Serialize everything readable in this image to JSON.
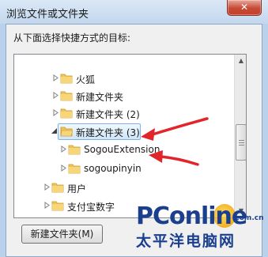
{
  "window": {
    "title": "浏览文件或文件夹",
    "close_glyph": "✕",
    "instruction": "从下面选择快捷方式的目标:"
  },
  "tree": {
    "items": [
      {
        "label": "火狐",
        "expander": "collapsed",
        "selected": false
      },
      {
        "label": "新建文件夹",
        "expander": "collapsed",
        "selected": false
      },
      {
        "label": "新建文件夹 (2)",
        "expander": "collapsed",
        "selected": false
      },
      {
        "label": "新建文件夹 (3)",
        "expander": "expanded",
        "selected": true
      },
      {
        "label": "SogouExtension",
        "expander": "collapsed",
        "selected": false
      },
      {
        "label": "sogoupinyin",
        "expander": "collapsed",
        "selected": false
      },
      {
        "label": "用户",
        "expander": "collapsed",
        "selected": false
      },
      {
        "label": "支付宝数字",
        "expander": "collapsed",
        "selected": false
      }
    ]
  },
  "buttons": {
    "new_folder": "新建文件夹(M)"
  },
  "watermark": {
    "logo_pc": "PC",
    "logo_online": "online",
    "domain": ".com.cn",
    "cn": "太平洋电脑网"
  },
  "colors": {
    "annotation_arrow": "#e2252b",
    "selection": "#cfe6fa",
    "folder": "#f1c35a"
  }
}
